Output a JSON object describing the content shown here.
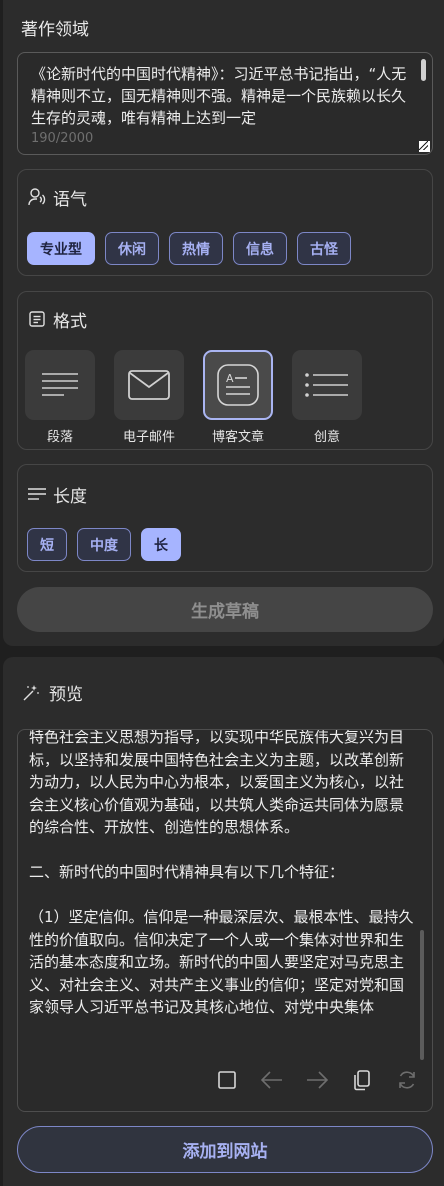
{
  "topic": {
    "title": "著作领域",
    "text": "《论新时代的中国时代精神》：习近平总书记指出，“人无精神则不立，国无精神则不强。精神是一个民族赖以长久生存的灵魂，唯有精神上达到一定",
    "char_count": "190/2000"
  },
  "tone": {
    "title": "语气",
    "icon": "voice-icon",
    "options": [
      "专业型",
      "休闲",
      "热情",
      "信息",
      "古怪"
    ],
    "selected": "专业型"
  },
  "format": {
    "title": "格式",
    "icon": "document-icon",
    "options": [
      "段落",
      "电子邮件",
      "博客文章",
      "创意"
    ],
    "selected": "博客文章"
  },
  "length": {
    "title": "长度",
    "icon": "lines-icon",
    "options": [
      "短",
      "中度",
      "长"
    ],
    "selected": "长"
  },
  "generate_button": "生成草稿",
  "preview": {
    "title": "预览",
    "icon": "magic-wand-icon",
    "text": "特色社会主义思想为指导，以实现中华民族伟大复兴为目标，以坚持和发展中国特色社会主义为主题，以改革创新为动力，以人民为中心为根本，以爱国主义为核心，以社会主义核心价值观为基础，以共筑人类命运共同体为愿景的综合性、开放性、创造性的思想体系。\n\n二、新时代的中国时代精神具有以下几个特征：\n\n（1）坚定信仰。信仰是一种最深层次、最根本性、最持久性的价值取向。信仰决定了一个人或一个集体对世界和生活的基本态度和立场。新时代的中国人要坚定对马克思主义、对社会主义、对共产主义事业的信仰；坚定对党和国家领导人习近平总书记及其核心地位、对党中央集体"
  },
  "add_button": "添加到网站",
  "colors": {
    "accent": "#a6b4ff",
    "panel": "#2c2c2c",
    "background": "#1f1f1f"
  }
}
